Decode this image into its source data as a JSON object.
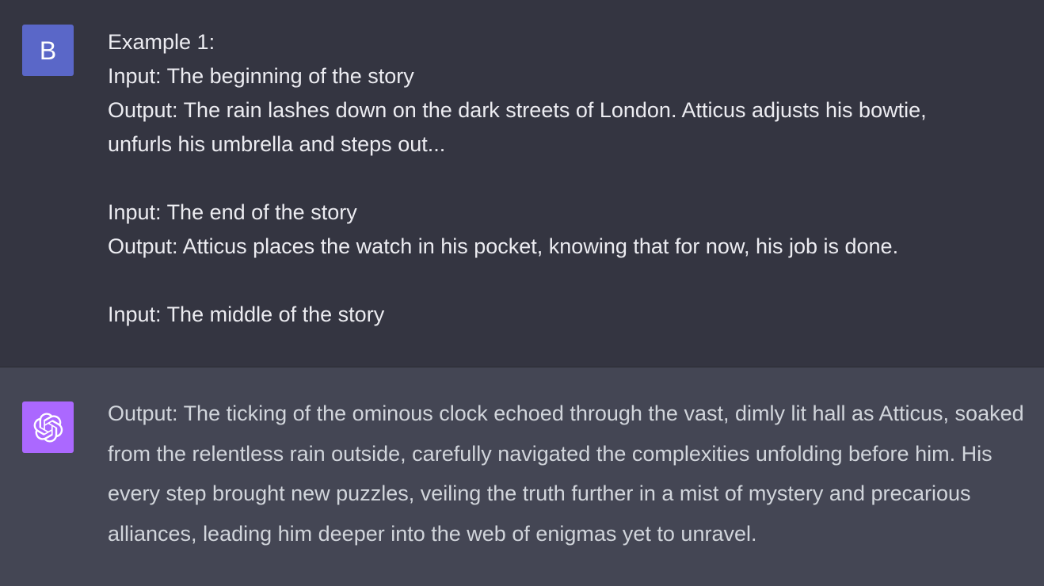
{
  "conversation": {
    "user_message": {
      "avatar": {
        "letter": "B",
        "color": "#5a67c8"
      },
      "lines": [
        "Example 1:",
        "Input: The beginning of the story",
        "Output: The rain lashes down on the dark streets of London. Atticus adjusts his bowtie,",
        "unfurls his umbrella and steps out...",
        "",
        "Input: The end of the story",
        "Output: Atticus places the watch in his pocket, knowing that for now, his job is done.",
        "",
        "Input: The middle of the story"
      ]
    },
    "assistant_message": {
      "avatar": {
        "icon": "openai-logo-icon",
        "color": "#ab68ff"
      },
      "text": "Output: The ticking of the ominous clock echoed through the vast, dimly lit hall as Atticus, soaked from the relentless rain outside, carefully navigated the complexities unfolding before him. His every step brought new puzzles, veiling the truth further in a mist of mystery and precarious alliances, leading him deeper into the web of enigmas yet to unravel."
    }
  },
  "colors": {
    "user_bg": "#343541",
    "assistant_bg": "#444654",
    "user_text": "#ececf1",
    "assistant_text": "#d1d5db"
  }
}
